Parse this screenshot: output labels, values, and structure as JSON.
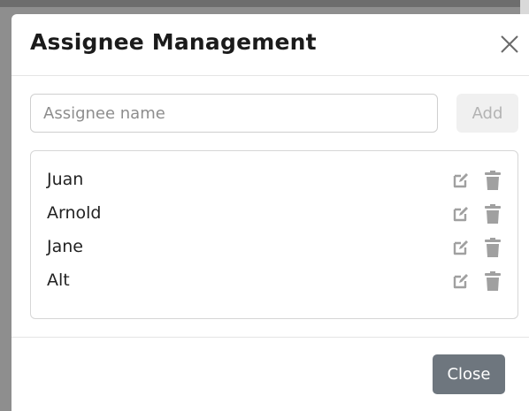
{
  "modal": {
    "title": "Assignee Management",
    "close_icon": "close-icon"
  },
  "form": {
    "input_value": "",
    "input_placeholder": "Assignee name",
    "add_label": "Add",
    "add_disabled": true
  },
  "assignees": [
    {
      "name": "Juan",
      "edit_icon": "edit-icon",
      "delete_icon": "trash-icon"
    },
    {
      "name": "Arnold",
      "edit_icon": "edit-icon",
      "delete_icon": "trash-icon"
    },
    {
      "name": "Jane",
      "edit_icon": "edit-icon",
      "delete_icon": "trash-icon"
    },
    {
      "name": "Alt",
      "edit_icon": "edit-icon",
      "delete_icon": "trash-icon"
    }
  ],
  "footer": {
    "close_label": "Close"
  },
  "colors": {
    "icon_gray": "#a0a0a0",
    "close_button_bg": "#6e767e",
    "add_button_bg": "#f0f0f0",
    "add_button_text": "#b3b3b3"
  }
}
